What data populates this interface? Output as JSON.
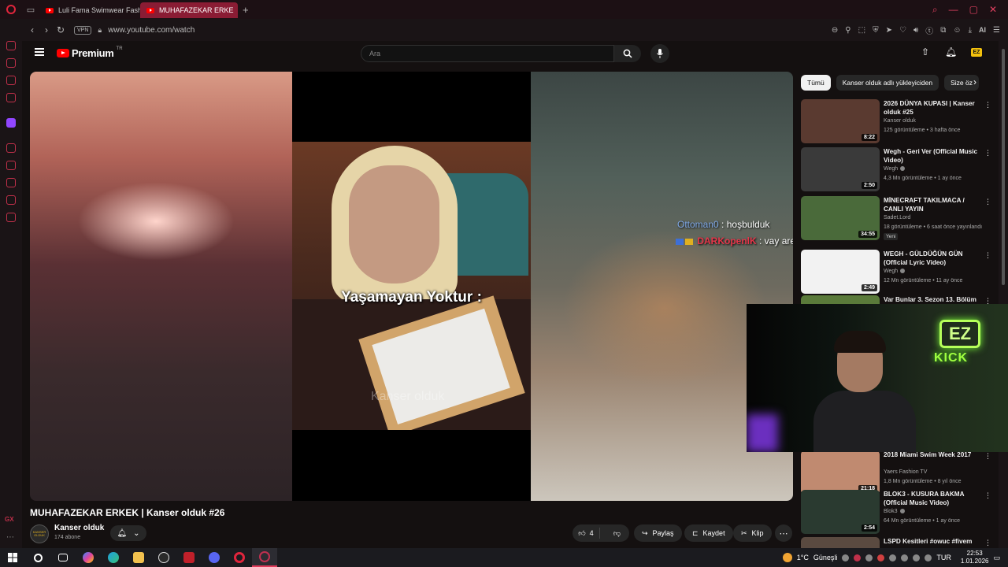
{
  "browser": {
    "tabs": [
      {
        "label": "Luli Fama Swimwear Fash"
      },
      {
        "label": "MUHAFAZEKAR ERKE"
      }
    ],
    "vpn_label": "VPN",
    "url": "www.youtube.com/watch",
    "ai_label": "AI"
  },
  "header": {
    "logo_text": "Premium",
    "logo_sup": "TR",
    "search_placeholder": "Ara"
  },
  "player": {
    "caption": "Yaşamayan Yoktur :",
    "watermark": "Kanser olduk",
    "chat": [
      {
        "user": "Ottoman0",
        "message": ": hoşbulduk"
      },
      {
        "user": "DARKopenlK",
        "message": ": vay arenacı flash"
      }
    ]
  },
  "video": {
    "title": "MUHAFAZEKAR ERKEK | Kanser olduk #26",
    "channel": "Kanser olduk",
    "avatar_text": "KANSER OLDUK",
    "subscribers": "174 abone",
    "likes": "4",
    "share_label": "Paylaş",
    "save_label": "Kaydet",
    "clip_label": "Klip"
  },
  "sidebar": {
    "chips": [
      {
        "label": "Tümü"
      },
      {
        "label": "Kanser olduk adlı yükleyiciden"
      },
      {
        "label": "Size öz"
      }
    ],
    "recs": [
      {
        "title": "2026 DÜNYA KUPASI | Kanser olduk #25",
        "channel": "Kanser olduk",
        "meta": "125 görüntüleme • 3 hafta önce",
        "duration": "8:22",
        "thumb_color": "#5a3a30"
      },
      {
        "title": "Wegh - Geri Ver (Official Music Video)",
        "channel": "Wegh",
        "meta": "4,3 Mn görüntüleme • 1 ay önce",
        "duration": "2:50",
        "thumb_color": "#3a3a3a"
      },
      {
        "title": "MİNECRAFT TAKILMACA / CANLI YAYIN",
        "channel": "Sadet.Lord",
        "meta": "18 görüntüleme • 6 saat önce yayınlandı",
        "duration": "34:55",
        "new_badge": "Yeni",
        "thumb_color": "#4a6a3a"
      },
      {
        "title": "WEGH - GÜLDÜĞÜN GÜN (Official Lyric Video)",
        "channel": "Wegh",
        "meta": "12 Mn görüntüleme • 11 ay önce",
        "duration": "2:49",
        "thumb_color": "#f2f2f2"
      },
      {
        "title": "Var Bunlar 3. Sezon 13. Bölüm",
        "thumb_color": "#5a7a3a"
      },
      {
        "title": "2018 Miami Swim Week 2017",
        "channel": "Yaers Fashion TV",
        "meta": "1,8 Mn görüntüleme • 8 yıl önce",
        "duration": "21:18",
        "thumb_color": "#c08a70"
      },
      {
        "title": "BLOK3 - KUSURA BAKMA (Official Music Video)",
        "channel": "Blok3",
        "meta": "64 Mn görüntüleme • 1 ay önce",
        "duration": "2:54",
        "thumb_color": "#2a3a30"
      },
      {
        "title": "LSPD Kesitleri #owuc #fivem",
        "thumb_color": "#5a4a40"
      }
    ]
  },
  "webcam": {
    "ez_sign": "EZ",
    "kick_sign": "KICK"
  },
  "taskbar": {
    "temperature": "1°C",
    "weather": "Güneşli",
    "lang": "TUR",
    "time": "22:53",
    "date": "1.01.2026"
  },
  "colors": {
    "accent": "#ff0000",
    "opera": "#e0253c",
    "background": "#0f0f0f"
  }
}
